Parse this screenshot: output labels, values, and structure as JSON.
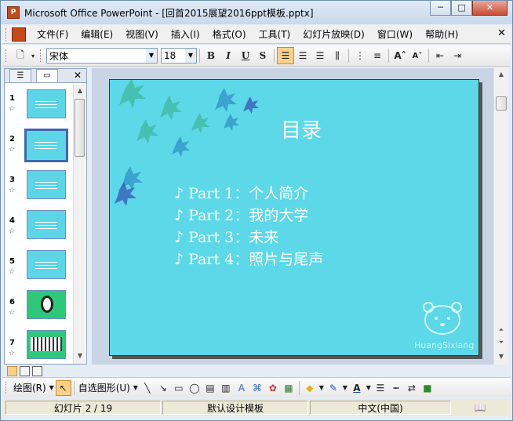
{
  "window": {
    "title": "Microsoft Office PowerPoint - [回首2015展望2016ppt模板.pptx]",
    "app_icon": "powerpoint-icon"
  },
  "menubar": {
    "items": [
      "文件(F)",
      "编辑(E)",
      "视图(V)",
      "插入(I)",
      "格式(O)",
      "工具(T)",
      "幻灯片放映(D)",
      "窗口(W)",
      "帮助(H)"
    ]
  },
  "toolbar": {
    "font_name": "宋体",
    "font_size": "18",
    "bold": "B",
    "italic": "I",
    "underline": "U",
    "shadow": "S"
  },
  "slide_pane": {
    "numbers": [
      "1",
      "2",
      "3",
      "4",
      "5",
      "6",
      "7"
    ],
    "selected_index": 1
  },
  "slide": {
    "title": "目录",
    "items": [
      "♪ Part 1：个人简介",
      "♪ Part 2：我的大学",
      "♪ Part 3：未来",
      "♪ Part 4：照片与尾声"
    ],
    "watermark": "HuangSixiang",
    "background_color": "#5cd8e8"
  },
  "drawbar": {
    "draw_label": "绘图(R)",
    "autoshape_label": "自选图形(U)"
  },
  "status": {
    "slide_info": "幻灯片 2 / 19",
    "template": "默认设计模板",
    "language": "中文(中国)"
  }
}
